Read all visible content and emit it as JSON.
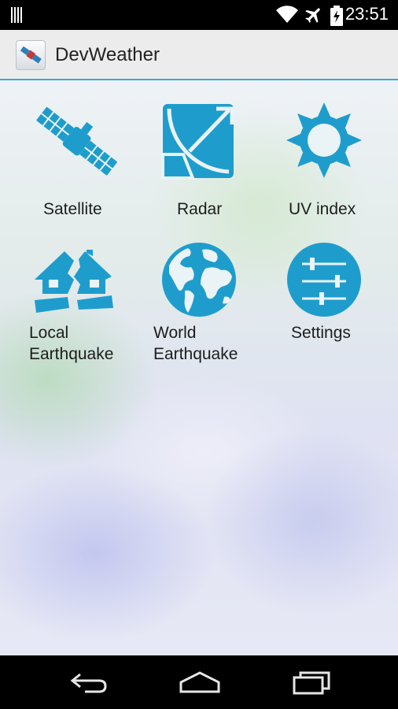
{
  "status_bar": {
    "time": "23:51",
    "icons": [
      "sim-icon",
      "wifi-icon",
      "airplane-icon",
      "battery-charging-icon"
    ]
  },
  "action_bar": {
    "title": "DevWeather",
    "app_icon": "satellite-app-icon"
  },
  "tiles": [
    {
      "id": "satellite",
      "label": "Satellite",
      "icon": "satellite-icon"
    },
    {
      "id": "radar",
      "label": "Radar",
      "icon": "radar-dish-icon"
    },
    {
      "id": "uv-index",
      "label": "UV index",
      "icon": "sun-icon"
    },
    {
      "id": "local-earthquake",
      "label_line1": "Local",
      "label_line2": "Earthquake",
      "icon": "broken-house-icon"
    },
    {
      "id": "world-earthquake",
      "label_line1": "World",
      "label_line2": "Earthquake",
      "icon": "globe-icon"
    },
    {
      "id": "settings",
      "label": "Settings",
      "icon": "sliders-icon"
    }
  ],
  "nav_bar": {
    "buttons": [
      "back-icon",
      "home-icon",
      "recents-icon"
    ]
  },
  "colors": {
    "icon_blue": "#1e9dcd",
    "action_bar_accent": "#39a9d6",
    "action_bar_bg": "#ececec"
  }
}
